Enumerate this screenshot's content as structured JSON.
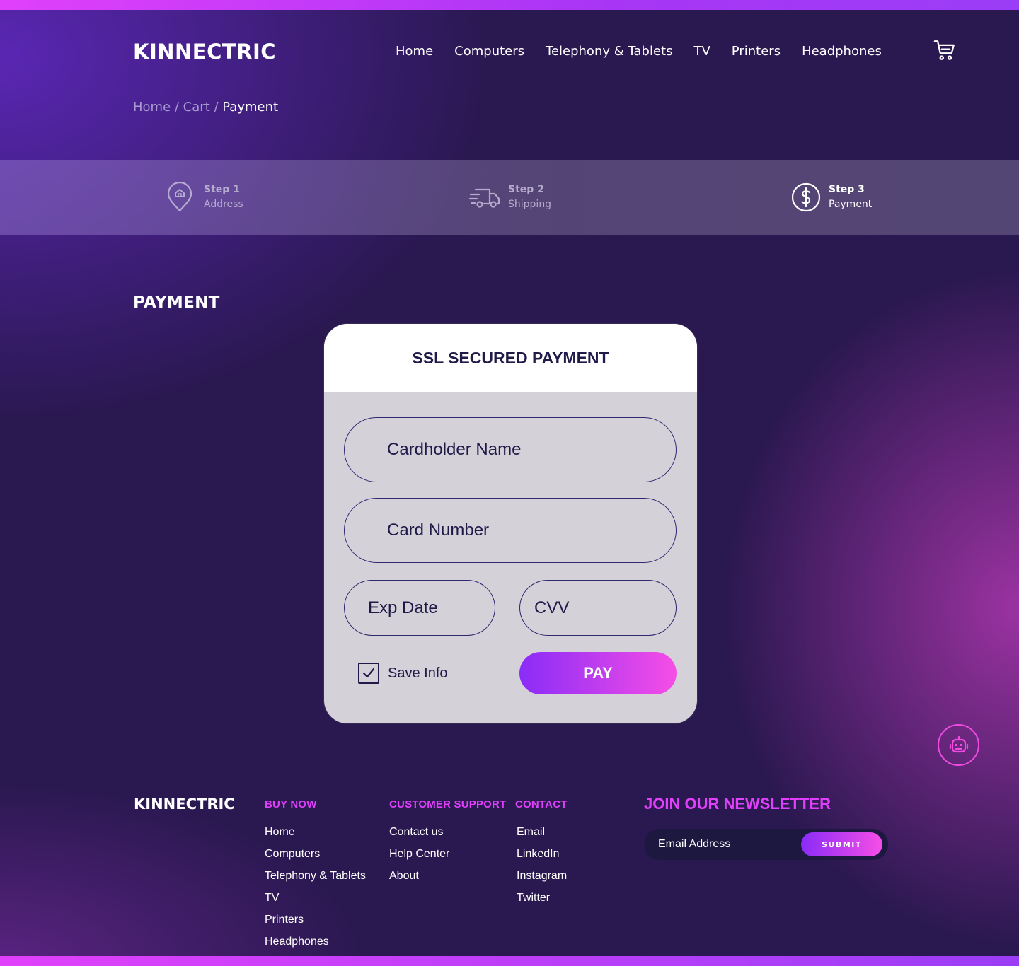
{
  "brand": {
    "name": "KINNECTRIC"
  },
  "nav": {
    "items": [
      "Home",
      "Computers",
      "Telephony & Tablets",
      "TV",
      "Printers",
      "Headphones"
    ]
  },
  "breadcrumb": {
    "home": "Home",
    "sep1": " / ",
    "cart": "Cart",
    "sep2": " / ",
    "current": "Payment"
  },
  "steps": [
    {
      "label": "Step 1",
      "name": "Address",
      "icon": "location-pin-icon",
      "state": "done"
    },
    {
      "label": "Step 2",
      "name": "Shipping",
      "icon": "delivery-truck-icon",
      "state": "done"
    },
    {
      "label": "Step 3",
      "name": "Payment",
      "icon": "dollar-circle-icon",
      "state": "active"
    }
  ],
  "payment": {
    "section_title": "PAYMENT",
    "card_title": "SSL SECURED PAYMENT",
    "cardholder_placeholder": "Cardholder Name",
    "card_number_placeholder": "Card Number",
    "exp_placeholder": "Exp Date",
    "cvv_placeholder": "CVV",
    "save_label": "Save Info",
    "save_checked": true,
    "pay_label": "PAY"
  },
  "chatbot": {
    "icon": "robot-icon"
  },
  "footer": {
    "brand": "KINNECTRIC",
    "buy_now": {
      "title": "BUY NOW",
      "links": [
        "Home",
        "Computers",
        "Telephony & Tablets",
        "TV",
        "Printers",
        "Headphones"
      ]
    },
    "support": {
      "title": "CUSTOMER SUPPORT",
      "links": [
        "Contact us",
        "Help Center",
        "About"
      ]
    },
    "contact": {
      "title": "CONTACT",
      "links": [
        "Email",
        "LinkedIn",
        "Instagram",
        "Twitter"
      ]
    },
    "newsletter": {
      "title": "JOIN OUR NEWSLETTER",
      "placeholder": "Email Address",
      "submit": "SUBMIT"
    }
  },
  "colors": {
    "accent": "#e040fb",
    "accent2": "#8a2cf7",
    "background": "#2a1850",
    "card": "#d4d1d9",
    "ink": "#1f1a48"
  }
}
